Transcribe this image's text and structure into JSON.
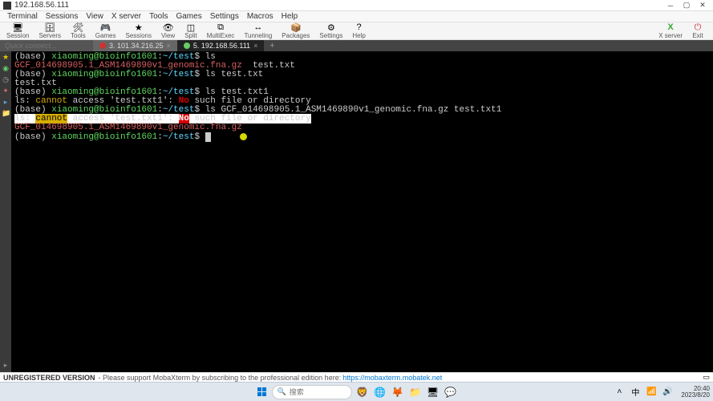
{
  "titlebar": {
    "title": "192.168.56.111"
  },
  "menubar": [
    "Terminal",
    "Sessions",
    "View",
    "X server",
    "Tools",
    "Games",
    "Settings",
    "Macros",
    "Help"
  ],
  "toolbar": {
    "left": [
      {
        "label": "Session",
        "icon": "🖥"
      },
      {
        "label": "Servers",
        "icon": "🗄"
      },
      {
        "label": "Tools",
        "icon": "🛠"
      },
      {
        "label": "Games",
        "icon": "🎮"
      },
      {
        "label": "Sessions",
        "icon": "★"
      },
      {
        "label": "View",
        "icon": "👁"
      },
      {
        "label": "Split",
        "icon": "◫"
      },
      {
        "label": "MultiExec",
        "icon": "⧉"
      },
      {
        "label": "Tunneling",
        "icon": "↔"
      },
      {
        "label": "Packages",
        "icon": "📦"
      },
      {
        "label": "Settings",
        "icon": "⚙"
      },
      {
        "label": "Help",
        "icon": "?"
      }
    ],
    "right": [
      {
        "label": "X server",
        "icon": "X"
      },
      {
        "label": "Exit",
        "icon": "⏻"
      }
    ]
  },
  "quick_connect_placeholder": "Quick connect...",
  "tabs": [
    {
      "label": "3. 101.34.216.25",
      "active": false,
      "icon": "red"
    },
    {
      "label": "5. 192.168.56.111",
      "active": true,
      "icon": "green"
    }
  ],
  "terminal": {
    "prompt_base": "(base) ",
    "prompt_user": "xiaoming@bioinfo1601",
    "prompt_sep": ":",
    "prompt_path": "~/test",
    "prompt_end": "$ ",
    "lines": [
      {
        "type": "prompt",
        "cmd": "ls"
      },
      {
        "type": "out",
        "segs": [
          {
            "cls": "file-gz",
            "t": "GCF_014698905.1_ASM1469890v1_genomic.fna.gz"
          },
          {
            "cls": "",
            "t": "  "
          },
          {
            "cls": "file-txt",
            "t": "test.txt"
          }
        ]
      },
      {
        "type": "prompt",
        "cmd": "ls test.txt"
      },
      {
        "type": "out",
        "segs": [
          {
            "cls": "file-txt",
            "t": "test.txt"
          }
        ]
      },
      {
        "type": "prompt",
        "cmd": "ls test.txt1"
      },
      {
        "type": "err",
        "segs": [
          {
            "cls": "err-ls",
            "t": "ls: "
          },
          {
            "cls": "err-cannot",
            "t": "cannot"
          },
          {
            "cls": "err-ls",
            "t": " access 'test.txt1': "
          },
          {
            "cls": "err-no",
            "t": "No"
          },
          {
            "cls": "err-ls",
            "t": " such file or directory"
          }
        ]
      },
      {
        "type": "prompt",
        "cmd": "ls GCF_014698905.1_ASM1469890v1_genomic.fna.gz test.txt1"
      },
      {
        "type": "err_hl",
        "segs": [
          {
            "cls": "err-ls",
            "t": "ls: "
          },
          {
            "cls": "err-cannot",
            "t": "cannot"
          },
          {
            "cls": "err-ls",
            "t": " access 'test.txt1': "
          },
          {
            "cls": "err-no",
            "t": "No"
          },
          {
            "cls": "err-ls",
            "t": " such file or directory"
          }
        ]
      },
      {
        "type": "out",
        "segs": [
          {
            "cls": "file-gz",
            "t": "GCF_014698905.1_ASM1469890v1_genomic.fna.gz"
          }
        ]
      },
      {
        "type": "prompt_cursor",
        "cmd": ""
      }
    ]
  },
  "statusbar": {
    "unreg": "UNREGISTERED VERSION",
    "sub": " - Please support MobaXterm by subscribing to the professional edition here: ",
    "link_text": "https://mobaxterm.mobatek.net",
    "link_href": "#"
  },
  "taskbar": {
    "search_placeholder": "搜索",
    "clock_time": "20:40",
    "clock_date": "2023/8/20"
  }
}
